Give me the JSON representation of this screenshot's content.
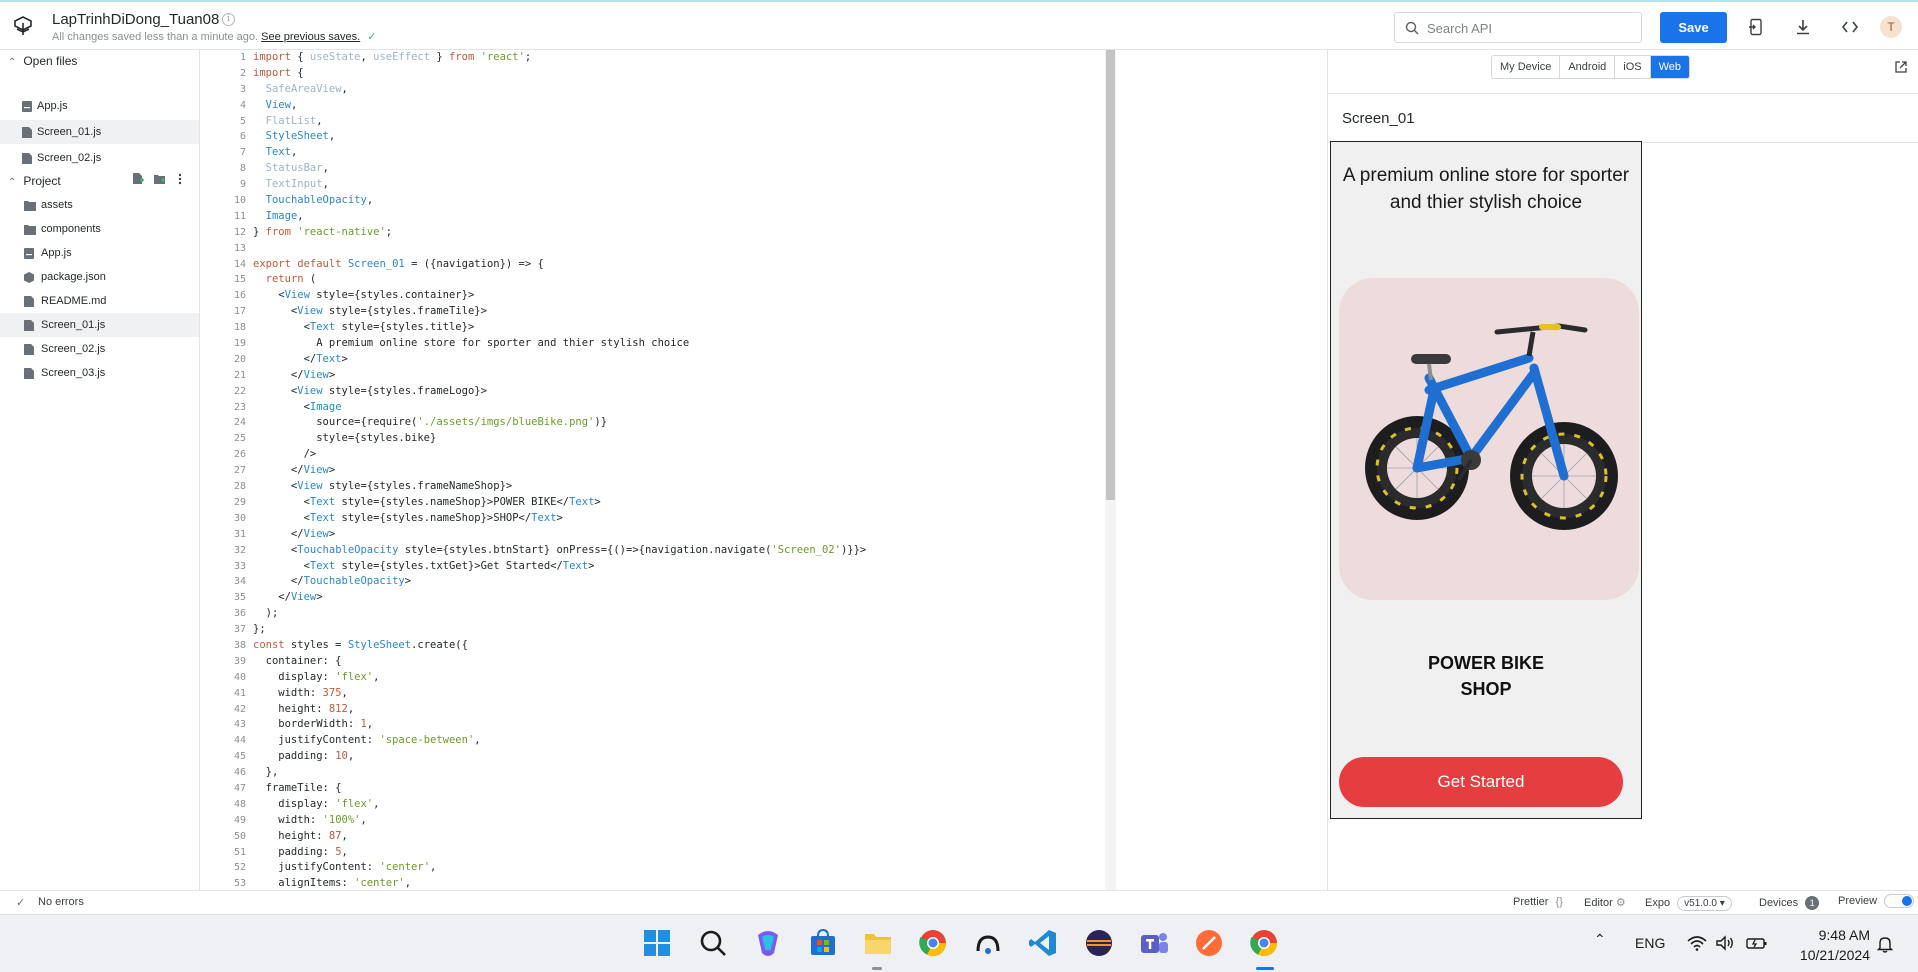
{
  "header": {
    "project_title": "LapTrinhDiDong_Tuan08",
    "info_glyph": "i",
    "save_status": "All changes saved less than a minute ago.",
    "previous_saves_link": "See previous saves.",
    "search_placeholder": "Search API",
    "save_label": "Save",
    "avatar_initial": "T"
  },
  "sidebar": {
    "open_files_title": "Open files",
    "open_files": [
      {
        "name": "App.js",
        "active": false
      },
      {
        "name": "Screen_01.js",
        "active": true
      },
      {
        "name": "Screen_02.js",
        "active": false
      }
    ],
    "project_title": "Project",
    "project_items": [
      {
        "name": "assets",
        "type": "folder"
      },
      {
        "name": "components",
        "type": "folder"
      },
      {
        "name": "App.js",
        "type": "js"
      },
      {
        "name": "package.json",
        "type": "pkg"
      },
      {
        "name": "README.md",
        "type": "md"
      },
      {
        "name": "Screen_01.js",
        "type": "file",
        "active": true
      },
      {
        "name": "Screen_02.js",
        "type": "file"
      },
      {
        "name": "Screen_03.js",
        "type": "file"
      }
    ]
  },
  "editor": {
    "lines": [
      "import { useState, useEffect } from 'react';",
      "import {",
      "  SafeAreaView,",
      "  View,",
      "  FlatList,",
      "  StyleSheet,",
      "  Text,",
      "  StatusBar,",
      "  TextInput,",
      "  TouchableOpacity,",
      "  Image,",
      "} from 'react-native';",
      "",
      "export default Screen_01 = ({navigation}) => {",
      "  return (",
      "    <View style={styles.container}>",
      "      <View style={styles.frameTile}>",
      "        <Text style={styles.title}>",
      "          A premium online store for sporter and thier stylish choice",
      "        </Text>",
      "      </View>",
      "      <View style={styles.frameLogo}>",
      "        <Image",
      "          source={require('./assets/imgs/blueBike.png')}",
      "          style={styles.bike}",
      "        />",
      "      </View>",
      "      <View style={styles.frameNameShop}>",
      "        <Text style={styles.nameShop}>POWER BIKE</Text>",
      "        <Text style={styles.nameShop}>SHOP</Text>",
      "      </View>",
      "      <TouchableOpacity style={styles.btnStart} onPress={()=>{navigation.navigate('Screen_02')}}>",
      "        <Text style={styles.txtGet}>Get Started</Text>",
      "      </TouchableOpacity>",
      "    </View>",
      "  );",
      "};",
      "const styles = StyleSheet.create({",
      "  container: {",
      "    display: 'flex',",
      "    width: 375,",
      "    height: 812,",
      "    borderWidth: 1,",
      "    justifyContent: 'space-between',",
      "    padding: 10,",
      "  },",
      "  frameTile: {",
      "    display: 'flex',",
      "    width: '100%',",
      "    height: 87,",
      "    padding: 5,",
      "    justifyContent: 'center',",
      "    alignItems: 'center',"
    ]
  },
  "preview": {
    "tabs": [
      {
        "label": "My Device",
        "active": false
      },
      {
        "label": "Android",
        "active": false
      },
      {
        "label": "iOS",
        "active": false
      },
      {
        "label": "Web",
        "active": true
      }
    ],
    "screen_name": "Screen_01",
    "app": {
      "title": "A premium online store for sporter and thier stylish choice",
      "shop_line1": "POWER BIKE",
      "shop_line2": "SHOP",
      "button": "Get Started"
    }
  },
  "statusbar": {
    "errors": "No errors",
    "prettier": "Prettier",
    "prettier_glyph": "{}",
    "editor": "Editor",
    "expo": "Expo",
    "expo_version": "v51.0.0 ▾",
    "devices": "Devices",
    "devices_count": "1",
    "preview": "Preview"
  },
  "taskbar": {
    "language": "ENG",
    "time": "9:48 AM",
    "date": "10/21/2024"
  },
  "colors": {
    "accent": "#1a73e8",
    "button": "#e63d40",
    "card": "#eedcdc"
  }
}
